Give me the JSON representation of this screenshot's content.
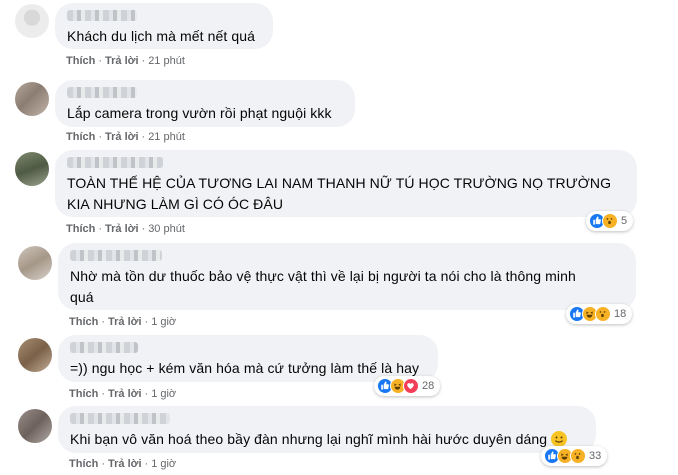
{
  "comments": [
    {
      "text_lines": [
        "Khách du lịch mà mết nết quá"
      ],
      "actions": {
        "like": "Thích",
        "reply": "Trả lời",
        "time": "21 phút"
      }
    },
    {
      "text_lines": [
        "Lắp camera trong vườn rồi phạt nguội kkk"
      ],
      "actions": {
        "like": "Thích",
        "reply": "Trả lời",
        "time": "21 phút"
      }
    },
    {
      "text_lines": [
        "TOÀN THẾ HỆ CỦA TƯƠNG LAI NAM THANH NỮ TÚ HỌC TRƯỜNG NỌ TRƯỜNG",
        "KIA NHƯNG LÀM GÌ CÓ ÓC ĐÂU"
      ],
      "actions": {
        "like": "Thích",
        "reply": "Trả lời",
        "time": "30 phút"
      },
      "reactions": {
        "count": "5",
        "types": [
          "like",
          "wow"
        ]
      }
    },
    {
      "text_lines": [
        "Nhờ mà tồn dư thuốc bảo vệ thực vật thì về lại bị người ta nói cho là thông minh",
        "quá"
      ],
      "actions": {
        "like": "Thích",
        "reply": "Trả lời",
        "time": "1 giờ"
      },
      "reactions": {
        "count": "18",
        "types": [
          "like",
          "haha",
          "wow"
        ]
      }
    },
    {
      "text_lines": [
        "=)) ngu học + kém văn hóa mà cứ tưởng làm thế là hay"
      ],
      "actions": {
        "like": "Thích",
        "reply": "Trả lời",
        "time": "1 giờ"
      },
      "reactions": {
        "count": "28",
        "types": [
          "like",
          "haha",
          "love"
        ]
      }
    },
    {
      "text_lines": [
        "Khi bạn vô văn hoá theo bầy đàn nhưng lại nghĩ mình hài hước duyên dáng"
      ],
      "actions": {
        "like": "Thích",
        "reply": "Trả lời",
        "time": "1 giờ"
      },
      "reactions": {
        "count": "33",
        "types": [
          "like",
          "haha",
          "wow"
        ]
      },
      "trailing_emoji": "smiling-face-emoji"
    }
  ],
  "colors": {
    "bubble": "#f0f2f5",
    "meta_text": "#65676b",
    "like": "#1877f2",
    "haha": "#f7b125",
    "love": "#f33e58"
  }
}
